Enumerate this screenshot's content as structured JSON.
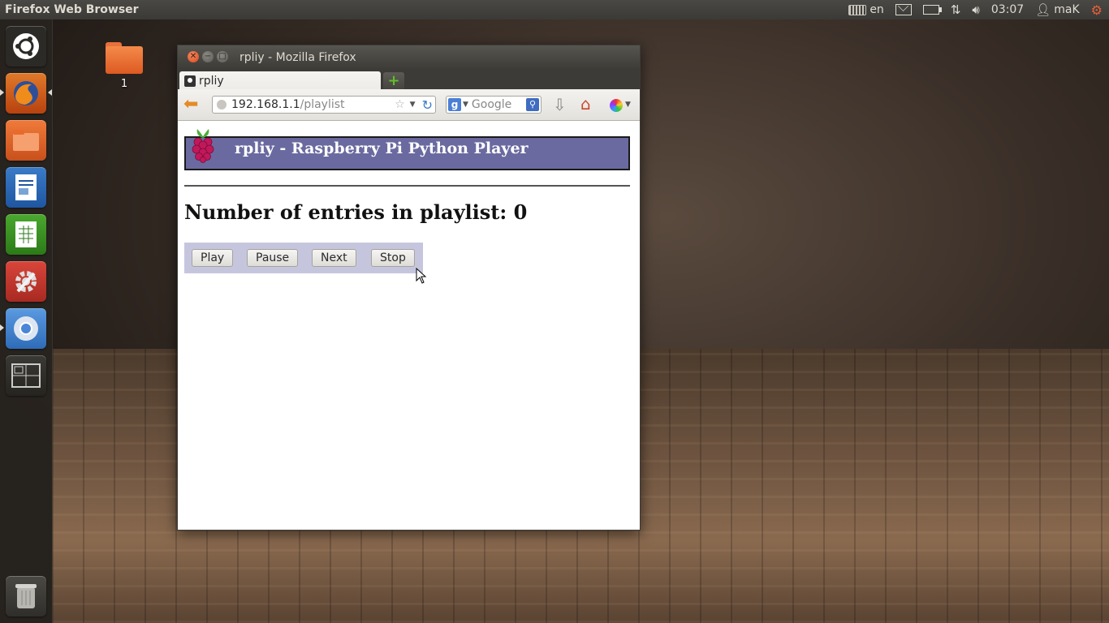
{
  "panel": {
    "app_title": "Firefox Web Browser",
    "keyboard_layout": "en",
    "time": "03:07",
    "user": "maK"
  },
  "launcher": {
    "items": [
      "ubuntu-dash",
      "firefox",
      "files",
      "libreoffice-writer",
      "libreoffice-calc",
      "system-settings",
      "chromium",
      "workspace-switcher",
      "trash"
    ]
  },
  "desktop": {
    "folder_label": "1"
  },
  "window": {
    "title": "rpliy - Mozilla Firefox",
    "tab_label": "rpliy",
    "new_tab_symbol": "+",
    "url_host": "192.168.1.1",
    "url_path": "/playlist",
    "search_placeholder": "Google"
  },
  "page": {
    "banner_title": "rpliy - Raspberry Pi Python Player",
    "count_heading": "Number of entries in playlist: 0",
    "buttons": {
      "play": "Play",
      "pause": "Pause",
      "next": "Next",
      "stop": "Stop"
    }
  },
  "colors": {
    "banner_bg": "#6a6aa0",
    "controls_bg": "#c5c6de",
    "accent_orange": "#e5603a"
  }
}
